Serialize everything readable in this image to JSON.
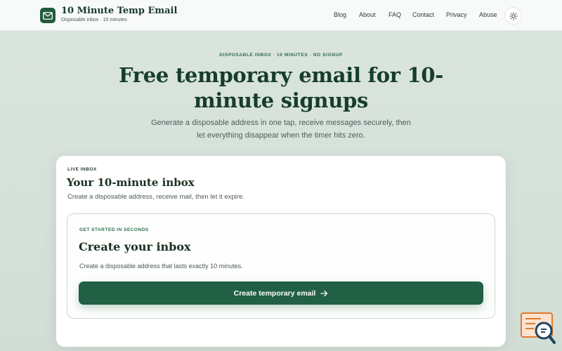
{
  "header": {
    "brand_title": "10 Minute Temp Email",
    "brand_subtitle": "Disposable inbox · 10 minutes",
    "logo_icon": "mail-icon",
    "nav": [
      {
        "label": "Blog"
      },
      {
        "label": "About"
      },
      {
        "label": "FAQ"
      },
      {
        "label": "Contact"
      },
      {
        "label": "Privacy"
      },
      {
        "label": "Abuse"
      }
    ],
    "theme_icon": "sun-icon"
  },
  "hero": {
    "eyebrow": "DISPOSABLE INBOX · 10 MINUTES · NO SIGNUP",
    "title": "Free temporary email for 10-minute signups",
    "description": "Generate a disposable address in one tap, receive messages securely, then let everything disappear when the timer hits zero."
  },
  "card": {
    "eyebrow": "LIVE INBOX",
    "title": "Your 10-minute inbox",
    "description": "Create a disposable address, receive mail, then let it expire.",
    "inner": {
      "eyebrow": "GET STARTED IN SECONDS",
      "title": "Create your inbox",
      "description": "Create a disposable address that lasts exactly 10 minutes.",
      "cta_label": "Create temporary email",
      "cta_icon": "arrow-right-icon"
    }
  },
  "widget": {
    "icon": "search-chat-icon"
  },
  "colors": {
    "accent": "#216045",
    "heading": "#163d2b",
    "background": "#d6e0da"
  }
}
